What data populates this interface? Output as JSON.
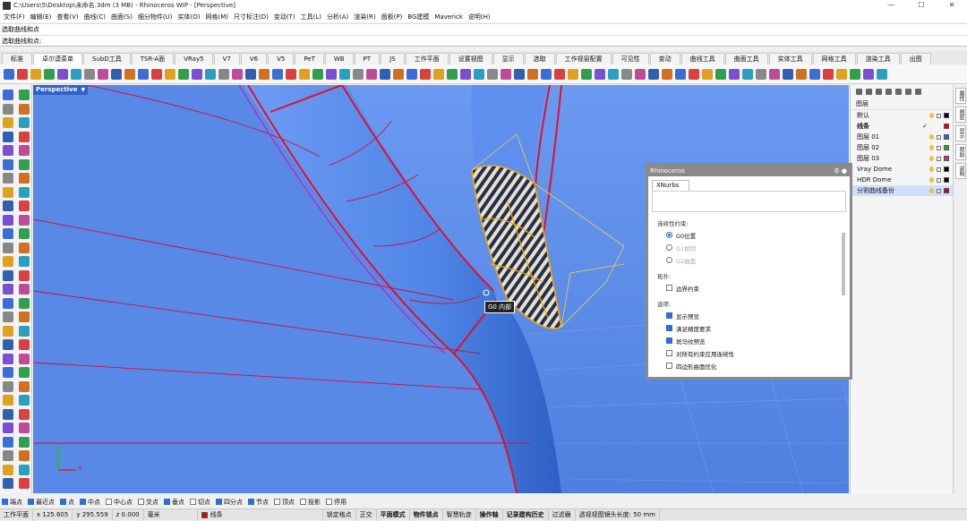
{
  "window": {
    "title": "C:\\Users\\5\\Desktop\\未命名.3dm (3 MB) - Rhinoceros WIP - [Perspective]",
    "buttons": [
      "—",
      "☐",
      "✕"
    ]
  },
  "menu": [
    "文件(F)",
    "编辑(E)",
    "查看(V)",
    "曲线(C)",
    "曲面(S)",
    "细分物件(U)",
    "实体(O)",
    "网格(M)",
    "尺寸标注(D)",
    "变动(T)",
    "工具(L)",
    "分析(A)",
    "渲染(R)",
    "面板(P)",
    "BG建模",
    "Maverick",
    "说明(H)"
  ],
  "command": {
    "history": "选取曲线和点",
    "prompt": "选取曲线和点:"
  },
  "tabs": [
    "标准",
    "卓尔谟菜单",
    "SubD工具",
    "TSR-A面",
    "VRay5",
    "V7",
    "V6",
    "V5",
    "PeT",
    "WB",
    "PT",
    "JS",
    "工作平面",
    "设置视图",
    "显示",
    "选取",
    "工作视窗配置",
    "可见性",
    "变动",
    "曲线工具",
    "曲面工具",
    "实体工具",
    "网格工具",
    "渲染工具",
    "出图"
  ],
  "active_tab": "卓尔谟菜单",
  "viewport": {
    "label": "Perspective",
    "tooltip": "G0 内部",
    "axis_x": "x",
    "axis_z": "z"
  },
  "layers": {
    "header": "图层",
    "items": [
      {
        "name": "默认",
        "color": "#000000",
        "current": false,
        "selected": false,
        "bold": false
      },
      {
        "name": "线条",
        "color": "#dd0000",
        "current": true,
        "selected": false,
        "bold": true
      },
      {
        "name": "图层 01",
        "color": "#1a6fd8",
        "current": false,
        "selected": false,
        "bold": false
      },
      {
        "name": "图层 02",
        "color": "#22aa22",
        "current": false,
        "selected": false,
        "bold": false
      },
      {
        "name": "图层 03",
        "color": "#e0208a",
        "current": false,
        "selected": false,
        "bold": false
      },
      {
        "name": "Vray Dome",
        "color": "#000000",
        "current": false,
        "selected": false,
        "bold": false
      },
      {
        "name": "HDR Dome",
        "color": "#000000",
        "current": false,
        "selected": false,
        "bold": false
      },
      {
        "name": "分割曲线备份",
        "color": "#dd0000",
        "current": false,
        "selected": true,
        "bold": false
      }
    ]
  },
  "sidetabs": [
    "属性",
    "图层",
    "显示",
    "帮助",
    "说明"
  ],
  "xnurbs_panel": {
    "title": "Rhinoceros",
    "tab": "XNurbs",
    "continuity_label": "连续性约束:",
    "continuity_options": [
      {
        "label": "G0位置",
        "checked": true,
        "disabled": false
      },
      {
        "label": "G1相切",
        "checked": false,
        "disabled": true
      },
      {
        "label": "G2曲面",
        "checked": false,
        "disabled": true
      }
    ],
    "topology_label": "拓扑:",
    "topology_options": [
      {
        "label": "边界约束",
        "checked": false
      }
    ],
    "options_label": "选项:",
    "options": [
      {
        "label": "显示预览",
        "checked": true
      },
      {
        "label": "满足精度要求",
        "checked": true
      },
      {
        "label": "斑马纹预览",
        "checked": true
      },
      {
        "label": "对所有约束应用连续性",
        "checked": false
      },
      {
        "label": "四边形曲面优化",
        "checked": false
      }
    ]
  },
  "osnaps": [
    {
      "label": "端点",
      "on": true
    },
    {
      "label": "最近点",
      "on": true
    },
    {
      "label": "点",
      "on": true
    },
    {
      "label": "中点",
      "on": true
    },
    {
      "label": "中心点",
      "on": false
    },
    {
      "label": "交点",
      "on": false
    },
    {
      "label": "垂点",
      "on": true
    },
    {
      "label": "切点",
      "on": false
    },
    {
      "label": "四分点",
      "on": true
    },
    {
      "label": "节点",
      "on": true
    },
    {
      "label": "顶点",
      "on": false
    },
    {
      "label": "投影",
      "on": false
    },
    {
      "label": "停用",
      "on": false
    }
  ],
  "status": {
    "cplane": "工作平面",
    "x": "x 125.605",
    "y": "y 295.559",
    "z": "z 0.000",
    "units": "毫米",
    "layer": "线条",
    "layer_color": "#dd0000",
    "toggles": [
      "锁定格点",
      "正交",
      "平面模式",
      "物件锁点",
      "智慧轨迹",
      "操作轴",
      "记录建构历史",
      "过滤器"
    ],
    "bold_toggles": [
      "平面模式",
      "物件锁点",
      "操作轴",
      "记录建构历史"
    ],
    "lens": "透视视图镜头长度: 50 mm"
  },
  "colors": {
    "viewport_bg": "#5b8fe8",
    "surface": "#4a7fdc",
    "edge": "#e01030",
    "highlight": "#f0a818"
  }
}
